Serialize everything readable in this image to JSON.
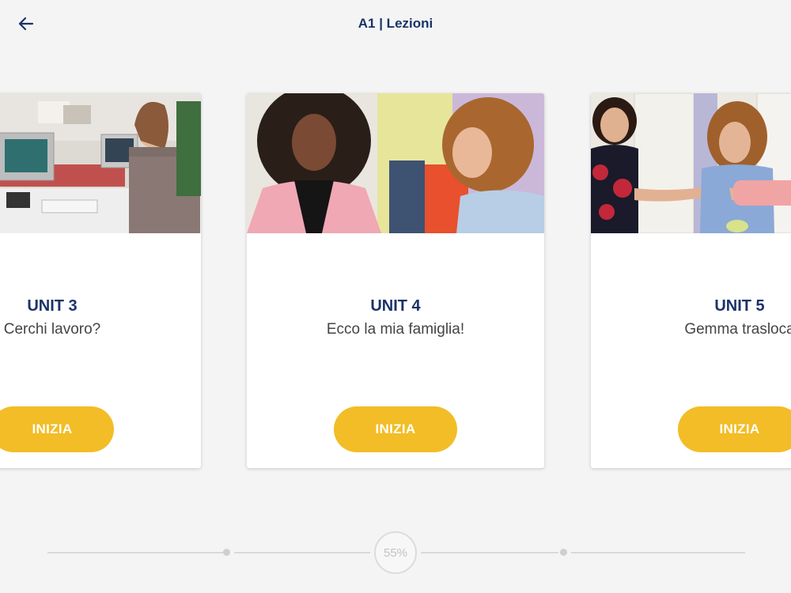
{
  "header": {
    "title": "A1 | Lezioni",
    "back_icon": "arrow-left-icon"
  },
  "cards": [
    {
      "unit": "UNIT 3",
      "title": "Cerchi lavoro?",
      "button": "INIZIA"
    },
    {
      "unit": "UNIT 4",
      "title": "Ecco la mia famiglia!",
      "button": "INIZIA"
    },
    {
      "unit": "UNIT 5",
      "title": "Gemma trasloca",
      "button": "INIZIA"
    }
  ],
  "progress": {
    "percent_label": "55%",
    "value": 55
  },
  "colors": {
    "accent": "#f2bd26",
    "title": "#1a3368",
    "background": "#f4f4f4"
  }
}
